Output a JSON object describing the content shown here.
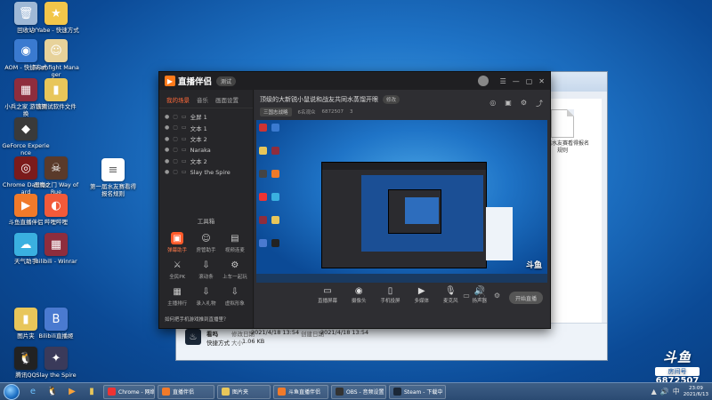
{
  "desktop": {
    "icons": [
      {
        "id": "recycle",
        "label": "回收站",
        "color": "#9fb9d6",
        "glyph": "🗑"
      },
      {
        "id": "ytatsu",
        "label": "YYabe - 快速方式",
        "color": "#f2c64a",
        "glyph": "★"
      },
      {
        "id": "aom",
        "label": "AOM - 快捷方式",
        "color": "#3a7ad0",
        "glyph": "◉"
      },
      {
        "id": "teamfight",
        "label": "Teamfight Manager",
        "color": "#e7d29a",
        "glyph": "☺"
      },
      {
        "id": "winrar",
        "label": "小兵之家 游戏转换",
        "color": "#8e2d3d",
        "glyph": "▦"
      },
      {
        "id": "folder1",
        "label": "该测试软件文件",
        "color": "#e8c65a",
        "glyph": "▮"
      },
      {
        "id": "geforce",
        "label": "GeForce Experience",
        "color": "#3a3a3a",
        "glyph": "◆"
      },
      {
        "id": "obs",
        "label": "Chrome Dashboard",
        "color": "#7b1b1b",
        "glyph": "◎"
      },
      {
        "id": "game2",
        "label": "恶魔之门 Way of Rue",
        "color": "#5a3a2a",
        "glyph": "☠"
      },
      {
        "id": "txtfile",
        "label": "第一届水友赛看得报名规则",
        "color": "#ffffff",
        "glyph": "≡"
      },
      {
        "id": "zhibo",
        "label": "斗鱼直播伴侣",
        "color": "#f07a2a",
        "glyph": "▶"
      },
      {
        "id": "bilibili",
        "label": "哔哩哔哩",
        "color": "#f25a3a",
        "glyph": "◐"
      },
      {
        "id": "weather",
        "label": "天气助手",
        "color": "#3ab0e0",
        "glyph": "☁"
      },
      {
        "id": "rar2",
        "label": "Bilibili - Winrar",
        "color": "#8e2d3d",
        "glyph": "▦"
      },
      {
        "id": "folder2",
        "label": "图片夹",
        "color": "#e8c65a",
        "glyph": "▮"
      },
      {
        "id": "b",
        "label": "Bilibili直播姬",
        "color": "#4a7ad0",
        "glyph": "B"
      },
      {
        "id": "qq",
        "label": "腾讯QQ",
        "color": "#222222",
        "glyph": "🐧"
      },
      {
        "id": "game3",
        "label": "Slay the Spire",
        "color": "#3a3a5a",
        "glyph": "✦"
      }
    ]
  },
  "explorer": {
    "file_label": "第一届水友赛看得报名规则",
    "details": {
      "name": "看吗",
      "modified_label": "修改日期",
      "modified": "2021/4/18 13:54",
      "created_label": "创建日期",
      "created": "2021/4/18 13:54",
      "type": "快捷方式",
      "size_label": "大小",
      "size": "1.06 KB"
    }
  },
  "app": {
    "name": "直播伴侣",
    "version_badge": "测试",
    "tabs": [
      "我的场景",
      "音乐",
      "画面设置"
    ],
    "layers": [
      "全屏 1",
      "文本 1",
      "文本 2",
      "Naraka",
      "文本 2",
      "Slay the Spire"
    ],
    "toolbox_title": "工具箱",
    "tools": [
      {
        "label": "弹幕助手",
        "glyph": "▣",
        "hot": true
      },
      {
        "label": "房管助手",
        "glyph": "☺",
        "hot": false
      },
      {
        "label": "视频连麦",
        "glyph": "▤",
        "hot": false
      },
      {
        "label": "全民PK",
        "glyph": "⚔",
        "hot": false
      },
      {
        "label": "滚动条",
        "glyph": "⇩",
        "hot": false
      },
      {
        "label": "上车一起玩",
        "glyph": "⚙",
        "hot": false
      },
      {
        "label": "主播排行",
        "glyph": "▦",
        "hot": false
      },
      {
        "label": "录入礼物",
        "glyph": "⇩",
        "hot": false
      },
      {
        "label": "虚拟形象",
        "glyph": "⇩",
        "hot": false
      }
    ],
    "tip": "如何把手机游戏推到直播里？",
    "room_title": "顶级的大新锐小鼠说和战友共同水蒸馏开眼",
    "room_edit": "修改",
    "category": "三国志战略",
    "viewers": "6名观众",
    "room_id": "6872507",
    "fans": "3",
    "controls": [
      {
        "label": "直播屏幕",
        "glyph": "▭"
      },
      {
        "label": "摄像头",
        "glyph": "◉"
      },
      {
        "label": "手机投屏",
        "glyph": "▯"
      },
      {
        "label": "多媒体",
        "glyph": "▶"
      },
      {
        "label": "麦克风",
        "glyph": "🎙"
      },
      {
        "label": "扬声器",
        "glyph": "🔊"
      }
    ],
    "start_button": "开始直播",
    "preview_logo": "斗鱼"
  },
  "taskbar": {
    "items": [
      {
        "label": "Chrome - 网络斗鱼",
        "color": "#e33"
      },
      {
        "label": "直播伴侣",
        "color": "#f07a2a"
      },
      {
        "label": "图片夹",
        "color": "#e8c65a"
      },
      {
        "label": "斗鱼直播伴侣",
        "color": "#f07a2a"
      },
      {
        "label": "OBS - 音频设置",
        "color": "#333"
      },
      {
        "label": "Steam - 下载中",
        "color": "#1b2838"
      }
    ],
    "clock_time": "23:09",
    "clock_date": "2021/6/13"
  },
  "watermark": {
    "brand": "斗鱼",
    "room_label": "房间号",
    "room_number": "6872507"
  }
}
